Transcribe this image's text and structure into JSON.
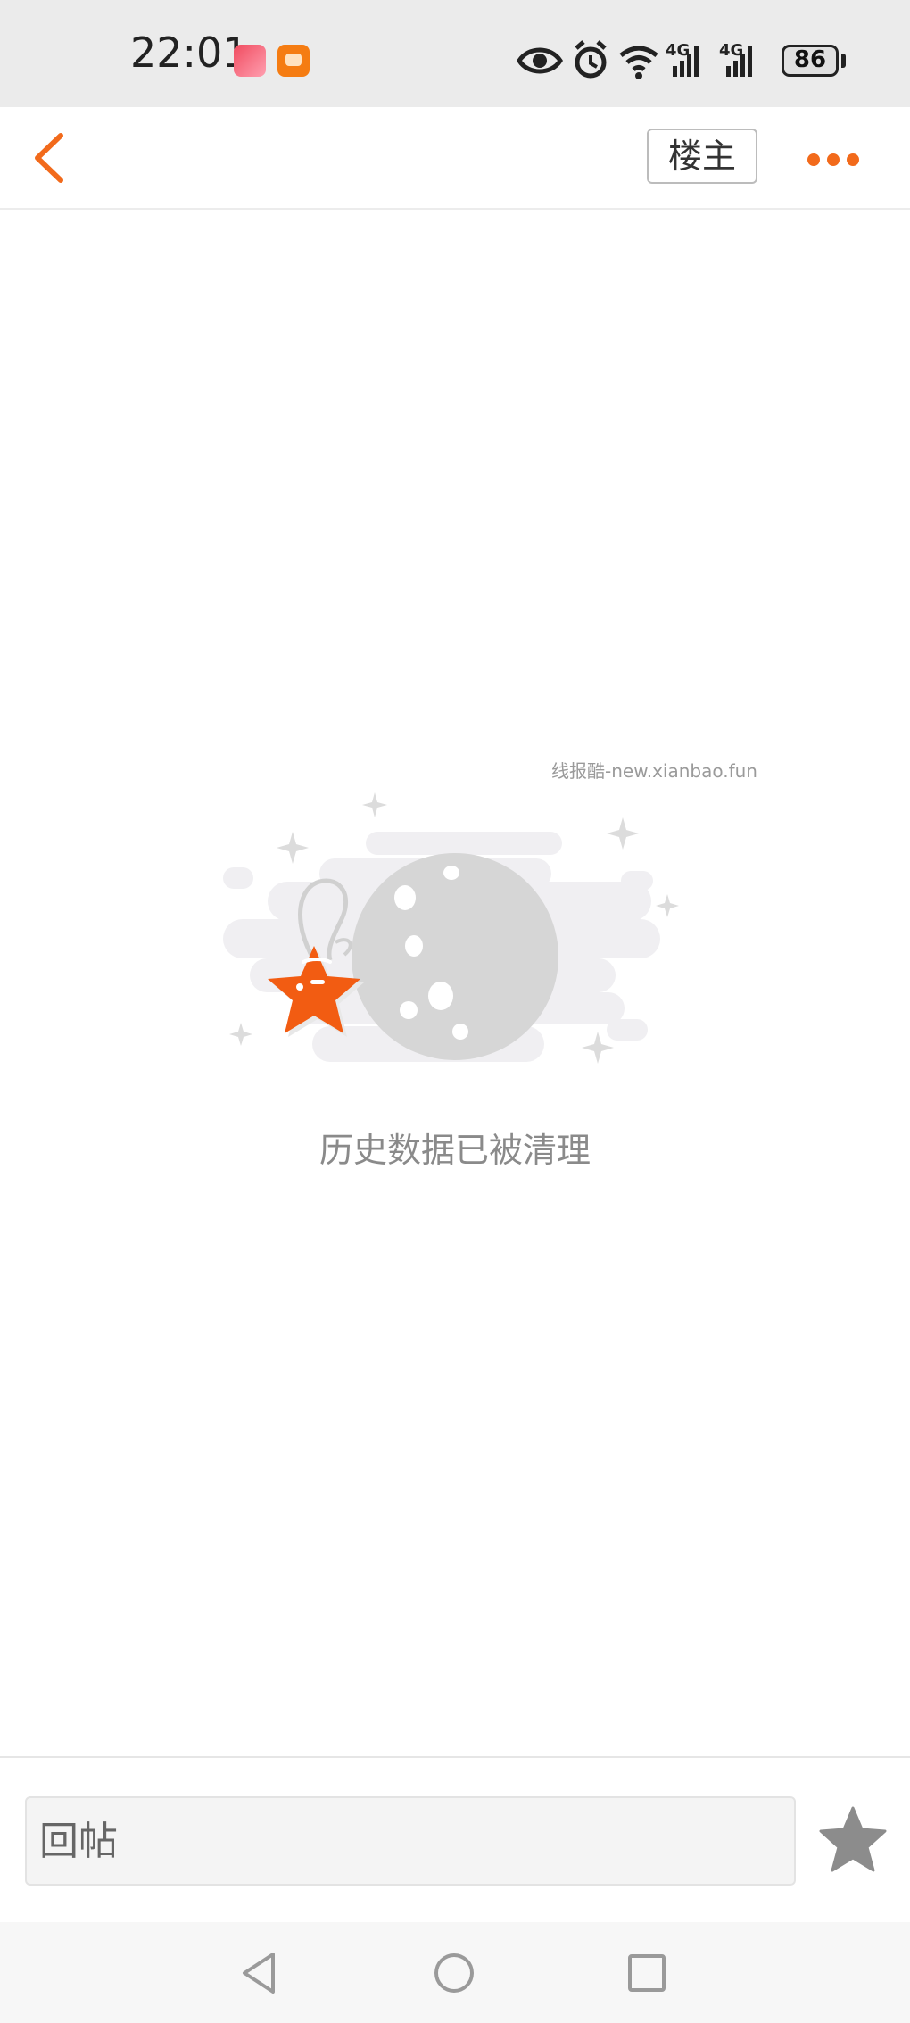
{
  "status_bar": {
    "time": "22:01",
    "battery": "86",
    "icons": [
      "app-notification-icon",
      "app-notification-icon",
      "eye-icon",
      "alarm-icon",
      "wifi-icon",
      "signal-4g-icon",
      "signal-4g-icon",
      "battery-icon"
    ]
  },
  "nav": {
    "back_icon": "chevron-left-icon",
    "owner_label": "楼主",
    "more_icon": "more-dots-icon"
  },
  "empty_state": {
    "message": "历史数据已被清理",
    "illustration": "moon-and-star-illustration"
  },
  "watermark": "线报酷-new.xianbao.fun",
  "reply_bar": {
    "placeholder": "回帖",
    "favorite_icon": "star-icon"
  },
  "system_nav": {
    "icons": [
      "back-triangle-icon",
      "home-circle-icon",
      "recent-square-icon"
    ]
  },
  "colors": {
    "accent": "#f26a1b",
    "status_bg": "#ebebeb",
    "muted_text": "#8a8a8a",
    "illustration_gray": "#d8d8d8"
  }
}
